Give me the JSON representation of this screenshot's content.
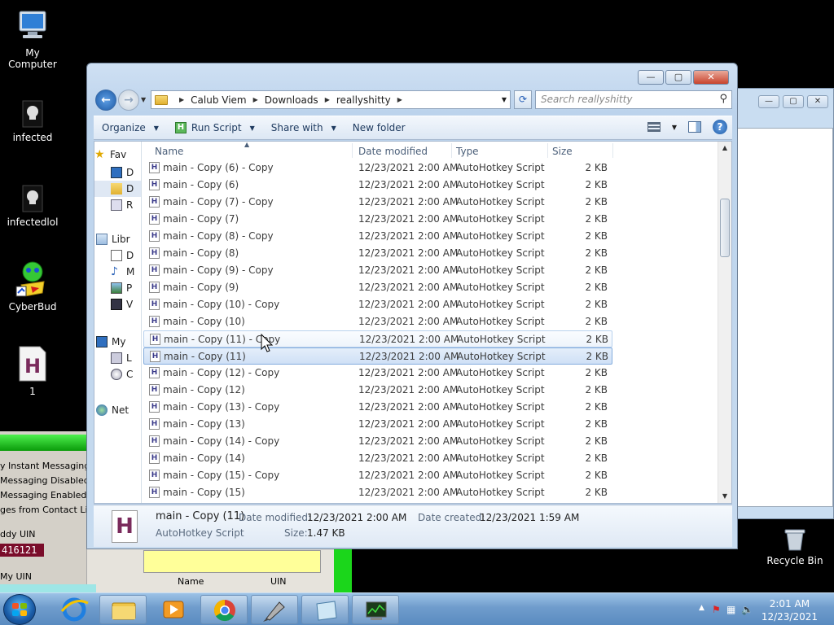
{
  "desktop": {
    "icons": [
      {
        "label": "My Computer"
      },
      {
        "label": "infected"
      },
      {
        "label": "infectedlol"
      },
      {
        "label": "CyberBud"
      },
      {
        "label": "1"
      }
    ],
    "recycle_label": "Recycle Bin"
  },
  "bg_app": {
    "list": [
      "y Instant Messaging",
      "Messaging Disabled",
      "Messaging Enabled",
      "ges from Contact List O"
    ],
    "buddy_uin_label": "ddy UIN",
    "buddy_uin_value": "416121",
    "my_uin_label": "My UIN",
    "col_name": "Name",
    "col_uin": "UIN"
  },
  "window": {
    "caption_buttons": {
      "minimize": "—",
      "maximize": "▢",
      "close": "✕"
    },
    "breadcrumb": [
      "Calub Viem",
      "Downloads",
      "reallyshitty"
    ],
    "search_placeholder": "Search reallyshitty",
    "toolbar": {
      "organize": "Organize",
      "run_script": "Run Script",
      "share_with": "Share with",
      "new_folder": "New folder"
    },
    "nav": [
      {
        "label": "Fav",
        "icon": "star-icon"
      },
      {
        "label": "D",
        "icon": "desktop-icon"
      },
      {
        "label": "D",
        "icon": "downloads-folder-icon"
      },
      {
        "label": "R",
        "icon": "recent-places-icon"
      },
      {
        "label": "Libr",
        "icon": "libraries-icon"
      },
      {
        "label": "D",
        "icon": "documents-icon"
      },
      {
        "label": "M",
        "icon": "music-icon"
      },
      {
        "label": "P",
        "icon": "pictures-icon"
      },
      {
        "label": "V",
        "icon": "videos-icon"
      },
      {
        "label": "My",
        "icon": "computer-icon"
      },
      {
        "label": "L",
        "icon": "local-disk-icon"
      },
      {
        "label": "C",
        "icon": "cd-drive-icon"
      },
      {
        "label": "Net",
        "icon": "network-icon"
      }
    ],
    "columns": {
      "name": "Name",
      "date": "Date modified",
      "type": "Type",
      "size": "Size"
    },
    "files": [
      {
        "name": "main - Copy (6) - Copy",
        "date": "12/23/2021 2:00 AM",
        "type": "AutoHotkey Script",
        "size": "2 KB"
      },
      {
        "name": "main - Copy (6)",
        "date": "12/23/2021 2:00 AM",
        "type": "AutoHotkey Script",
        "size": "2 KB"
      },
      {
        "name": "main - Copy (7) - Copy",
        "date": "12/23/2021 2:00 AM",
        "type": "AutoHotkey Script",
        "size": "2 KB"
      },
      {
        "name": "main - Copy (7)",
        "date": "12/23/2021 2:00 AM",
        "type": "AutoHotkey Script",
        "size": "2 KB"
      },
      {
        "name": "main - Copy (8) - Copy",
        "date": "12/23/2021 2:00 AM",
        "type": "AutoHotkey Script",
        "size": "2 KB"
      },
      {
        "name": "main - Copy (8)",
        "date": "12/23/2021 2:00 AM",
        "type": "AutoHotkey Script",
        "size": "2 KB"
      },
      {
        "name": "main - Copy (9) - Copy",
        "date": "12/23/2021 2:00 AM",
        "type": "AutoHotkey Script",
        "size": "2 KB"
      },
      {
        "name": "main - Copy (9)",
        "date": "12/23/2021 2:00 AM",
        "type": "AutoHotkey Script",
        "size": "2 KB"
      },
      {
        "name": "main - Copy (10) - Copy",
        "date": "12/23/2021 2:00 AM",
        "type": "AutoHotkey Script",
        "size": "2 KB"
      },
      {
        "name": "main - Copy (10)",
        "date": "12/23/2021 2:00 AM",
        "type": "AutoHotkey Script",
        "size": "2 KB"
      },
      {
        "name": "main - Copy (11) - Copy",
        "date": "12/23/2021 2:00 AM",
        "type": "AutoHotkey Script",
        "size": "2 KB",
        "state": "hover"
      },
      {
        "name": "main - Copy (11)",
        "date": "12/23/2021 2:00 AM",
        "type": "AutoHotkey Script",
        "size": "2 KB",
        "state": "selected"
      },
      {
        "name": "main - Copy (12) - Copy",
        "date": "12/23/2021 2:00 AM",
        "type": "AutoHotkey Script",
        "size": "2 KB"
      },
      {
        "name": "main - Copy (12)",
        "date": "12/23/2021 2:00 AM",
        "type": "AutoHotkey Script",
        "size": "2 KB"
      },
      {
        "name": "main - Copy (13) - Copy",
        "date": "12/23/2021 2:00 AM",
        "type": "AutoHotkey Script",
        "size": "2 KB"
      },
      {
        "name": "main - Copy (13)",
        "date": "12/23/2021 2:00 AM",
        "type": "AutoHotkey Script",
        "size": "2 KB"
      },
      {
        "name": "main - Copy (14) - Copy",
        "date": "12/23/2021 2:00 AM",
        "type": "AutoHotkey Script",
        "size": "2 KB"
      },
      {
        "name": "main - Copy (14)",
        "date": "12/23/2021 2:00 AM",
        "type": "AutoHotkey Script",
        "size": "2 KB"
      },
      {
        "name": "main - Copy (15) - Copy",
        "date": "12/23/2021 2:00 AM",
        "type": "AutoHotkey Script",
        "size": "2 KB"
      },
      {
        "name": "main - Copy (15)",
        "date": "12/23/2021 2:00 AM",
        "type": "AutoHotkey Script",
        "size": "2 KB"
      }
    ],
    "details": {
      "name": "main - Copy (11)",
      "type": "AutoHotkey Script",
      "date_modified_label": "Date modified:",
      "date_modified": "12/23/2021 2:00 AM",
      "date_created_label": "Date created:",
      "date_created": "12/23/2021 1:59 AM",
      "size_label": "Size:",
      "size": "1.47 KB"
    }
  },
  "taskbar": {
    "items": [
      "explorer",
      "internet-explorer",
      "file-explorer",
      "media-player",
      "chrome",
      "script-tool",
      "notepad",
      "task-manager"
    ],
    "clock_time": "2:01 AM",
    "clock_date": "12/23/2021"
  },
  "colors": {
    "selection": "#cfe0f6",
    "selection_border": "#84acdd",
    "taskbar": "#6f9ccc"
  }
}
